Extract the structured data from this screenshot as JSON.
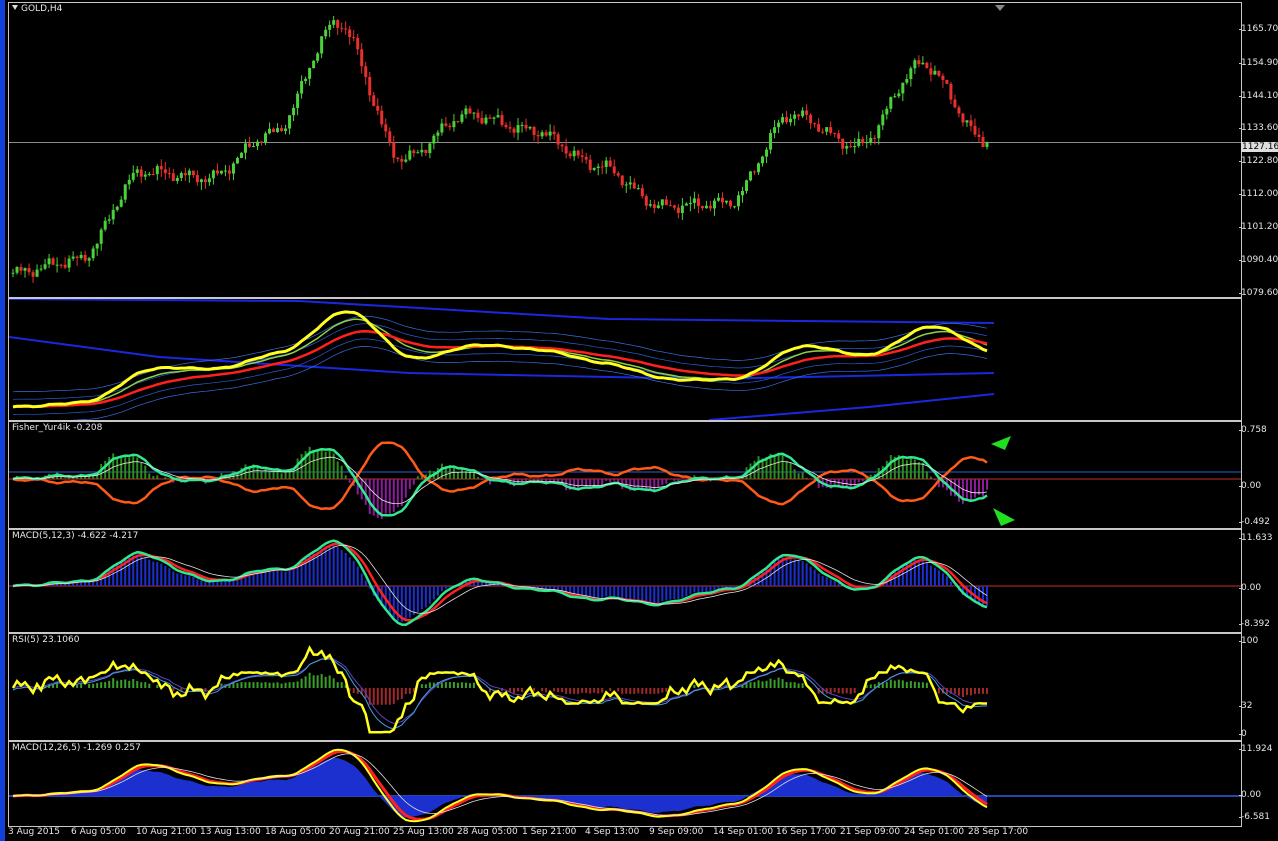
{
  "chart": {
    "symbol_title": "GOLD,H4",
    "current_price": "1127.16",
    "price_ticks": [
      "1165.70",
      "1154.90",
      "1144.10",
      "1133.60",
      "1122.80",
      "1112.00",
      "1101.20",
      "1090.40",
      "1079.60"
    ]
  },
  "panes": {
    "fisher": {
      "title": "Fisher_Yur4ik -0.208",
      "ticks": [
        "0.758",
        "0.00",
        "-0.492"
      ]
    },
    "macd_fast": {
      "title": "MACD(5,12,3) -4.622 -4.217",
      "ticks": [
        "11.633",
        "0.00",
        "-8.392"
      ]
    },
    "rsi": {
      "title": "RSI(5) 23.1060",
      "ticks": [
        "100",
        "32",
        "0"
      ]
    },
    "macd_slow": {
      "title": "MACD(12,26,5) -1.269 0.257",
      "ticks": [
        "11.924",
        "0.00",
        "-6.581"
      ]
    }
  },
  "time_labels": [
    "3 Aug 2015",
    "6 Aug 05:00",
    "10 Aug 21:00",
    "13 Aug 13:00",
    "18 Aug 05:00",
    "20 Aug 21:00",
    "25 Aug 13:00",
    "28 Aug 05:00",
    "1 Sep 21:00",
    "4 Sep 13:00",
    "9 Sep 09:00",
    "14 Sep 01:00",
    "16 Sep 17:00",
    "21 Sep 09:00",
    "24 Sep 01:00",
    "28 Sep 17:00"
  ],
  "colors": {
    "bull_candle": "#4bd23a",
    "bear_candle": "#e8302c",
    "yellow_line": "#ffff20",
    "red_line": "#ff2020",
    "blue_band": "#1a28e0",
    "histo_green": "#2c8c1c",
    "histo_purple": "#8c1c9c",
    "histo_blue": "#1c30d0",
    "aqua_line": "#30e890",
    "orange_line": "#ff5a18",
    "arrow_green": "#20e020"
  },
  "chart_data": {
    "type": "line",
    "title": "GOLD,H4",
    "x": [
      "3 Aug 2015",
      "6 Aug 05:00",
      "10 Aug 21:00",
      "13 Aug 13:00",
      "18 Aug 05:00",
      "20 Aug 21:00",
      "25 Aug 13:00",
      "28 Aug 05:00",
      "1 Sep 21:00",
      "4 Sep 13:00",
      "9 Sep 09:00",
      "14 Sep 01:00",
      "16 Sep 17:00",
      "21 Sep 09:00",
      "24 Sep 01:00",
      "28 Sep 17:00"
    ],
    "series": [
      {
        "values": [
          1086,
          1090,
          1118,
          1116,
          1130,
          1165,
          1122,
          1136,
          1131,
          1120,
          1107,
          1108,
          1136,
          1126,
          1152,
          1127.16
        ]
      }
    ],
    "ylim": [
      1079.6,
      1170
    ]
  }
}
